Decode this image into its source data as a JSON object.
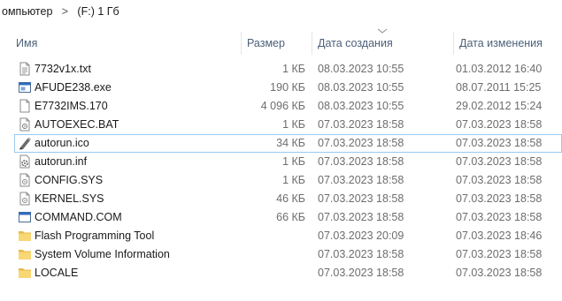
{
  "breadcrumb": {
    "parent": "омпьютер",
    "separator": ">",
    "current": "(F:) 1 Гб"
  },
  "columns": {
    "name": "Имя",
    "size": "Размер",
    "created": "Дата создания",
    "modified": "Дата изменения",
    "sorted_by": "created"
  },
  "files": [
    {
      "icon": "text-file-icon",
      "name": "7732v1x.txt",
      "size": "1 КБ",
      "created": "08.03.2023 10:55",
      "modified": "01.03.2012 16:40"
    },
    {
      "icon": "exe-file-icon",
      "name": "AFUDE238.exe",
      "size": "190 КБ",
      "created": "08.03.2023 10:55",
      "modified": "08.07.2011 15:25"
    },
    {
      "icon": "generic-file-icon",
      "name": "E7732IMS.170",
      "size": "4 096 КБ",
      "created": "08.03.2023 10:55",
      "modified": "29.02.2012 15:24"
    },
    {
      "icon": "bat-file-icon",
      "name": "AUTOEXEC.BAT",
      "size": "1 КБ",
      "created": "07.03.2023 18:58",
      "modified": "07.03.2023 18:58"
    },
    {
      "icon": "ico-file-icon",
      "name": "autorun.ico",
      "size": "34 КБ",
      "created": "07.03.2023 18:58",
      "modified": "07.03.2023 18:58"
    },
    {
      "icon": "settings-file-icon",
      "name": "autorun.inf",
      "size": "1 КБ",
      "created": "07.03.2023 18:58",
      "modified": "07.03.2023 18:58"
    },
    {
      "icon": "sys-file-icon",
      "name": "CONFIG.SYS",
      "size": "1 КБ",
      "created": "07.03.2023 18:58",
      "modified": "07.03.2023 18:58"
    },
    {
      "icon": "sys-file-icon",
      "name": "KERNEL.SYS",
      "size": "46 КБ",
      "created": "07.03.2023 18:58",
      "modified": "07.03.2023 18:58"
    },
    {
      "icon": "com-file-icon",
      "name": "COMMAND.COM",
      "size": "66 КБ",
      "created": "07.03.2023 18:58",
      "modified": "07.03.2023 18:58"
    },
    {
      "icon": "folder-icon",
      "name": "Flash Programming Tool",
      "size": "",
      "created": "07.03.2023 20:09",
      "modified": "07.03.2023 18:46"
    },
    {
      "icon": "folder-icon",
      "name": "System Volume Information",
      "size": "",
      "created": "07.03.2023 18:58",
      "modified": "07.03.2023 18:58"
    },
    {
      "icon": "folder-icon",
      "name": "LOCALE",
      "size": "",
      "created": "07.03.2023 18:58",
      "modified": "07.03.2023 18:58"
    }
  ],
  "focused_row": 4,
  "colors": {
    "header_text": "#4c607a",
    "secondary_text": "#6d6d6d",
    "focus_outline": "#99c9ef",
    "folder_yellow": "#f8d775"
  }
}
